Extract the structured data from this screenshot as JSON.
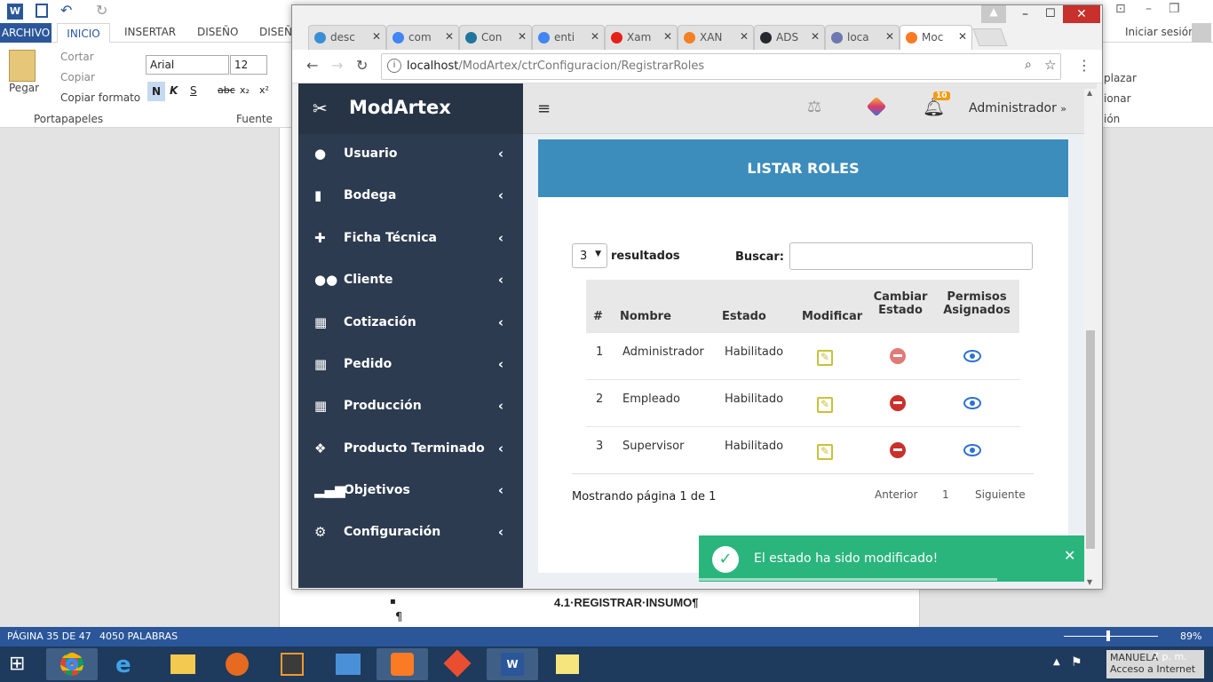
{
  "word": {
    "tabs": [
      "ARCHIVO",
      "INICIO",
      "INSERTAR",
      "DISEÑO",
      "DISEÑ"
    ],
    "signin": "Iniciar sesión",
    "clipboard": {
      "paste": "Pegar",
      "cut": "Cortar",
      "copy": "Copiar",
      "format_painter": "Copiar formato",
      "group": "Portapapeles"
    },
    "font": {
      "name": "Arial",
      "size": "12",
      "group": "Fuente",
      "bold": "N",
      "italic": "K",
      "underline": "S",
      "strike": "abc",
      "sub": "x₂",
      "sup": "x²"
    },
    "right_ribbon": {
      "replace": "plazar",
      "select": "ionar",
      "group": "ión"
    },
    "doc_heading": "4.1·REGISTRAR·INSUMO¶",
    "pilcrow": "¶",
    "status": {
      "page": "PÁGINA 35 DE 47",
      "words": "4050 PALABRAS",
      "zoom": "89%"
    }
  },
  "taskbar": {
    "user_tooltip_1": "MANUELA",
    "user_tooltip_2": "Acceso a Internet",
    "time": "7 p. m."
  },
  "chrome": {
    "tabs": [
      {
        "label": "desc",
        "color": "#3b8fd6"
      },
      {
        "label": "com",
        "color": "#4285f4"
      },
      {
        "label": "Con",
        "color": "#21759b"
      },
      {
        "label": "enti",
        "color": "#4285f4"
      },
      {
        "label": "Xam",
        "color": "#e62117"
      },
      {
        "label": "XAN",
        "color": "#f48024"
      },
      {
        "label": "ADS",
        "color": "#24292e"
      },
      {
        "label": "loca",
        "color": "#6c78af"
      },
      {
        "label": "Moc",
        "color": "#fb7a24"
      }
    ],
    "url_host": "localhost",
    "url_path": "/ModArtex/ctrConfiguracion/RegistrarRoles"
  },
  "app": {
    "brand": "ModArtex",
    "menu": [
      {
        "label": "Usuario",
        "icon": "user-icon"
      },
      {
        "label": "Bodega",
        "icon": "truck-icon"
      },
      {
        "label": "Ficha Técnica",
        "icon": "puzzle-icon"
      },
      {
        "label": "Cliente",
        "icon": "users-icon"
      },
      {
        "label": "Cotización",
        "icon": "calculator-icon"
      },
      {
        "label": "Pedido",
        "icon": "calendar-icon"
      },
      {
        "label": "Producción",
        "icon": "calendar-icon"
      },
      {
        "label": "Producto Terminado",
        "icon": "dropbox-icon"
      },
      {
        "label": "Objetivos",
        "icon": "signal-icon"
      },
      {
        "label": "Configuración",
        "icon": "gears-icon"
      }
    ],
    "notifications_count": "10",
    "user": "Administrador",
    "box_title": "LISTAR ROLES",
    "length_value": "3",
    "length_label": "resultados",
    "search_label": "Buscar:",
    "search_value": "",
    "columns": [
      "#",
      "Nombre",
      "Estado",
      "Modificar",
      "Cambiar Estado",
      "Permisos Asignados"
    ],
    "rows": [
      {
        "num": "1",
        "name": "Administrador",
        "status": "Habilitado"
      },
      {
        "num": "2",
        "name": "Empleado",
        "status": "Habilitado"
      },
      {
        "num": "3",
        "name": "Supervisor",
        "status": "Habilitado"
      }
    ],
    "info": "Mostrando página 1 de 1",
    "pager": {
      "prev": "Anterior",
      "page": "1",
      "next": "Siguiente"
    },
    "toast": "El estado ha sido modificado!",
    "colors": {
      "sidebar": "#2c3b4f",
      "header": "#3c8dbc",
      "toast": "#2ab57d",
      "edit": "#c8c23a",
      "disable": "#c9302c",
      "view": "#2f6fd6"
    }
  }
}
